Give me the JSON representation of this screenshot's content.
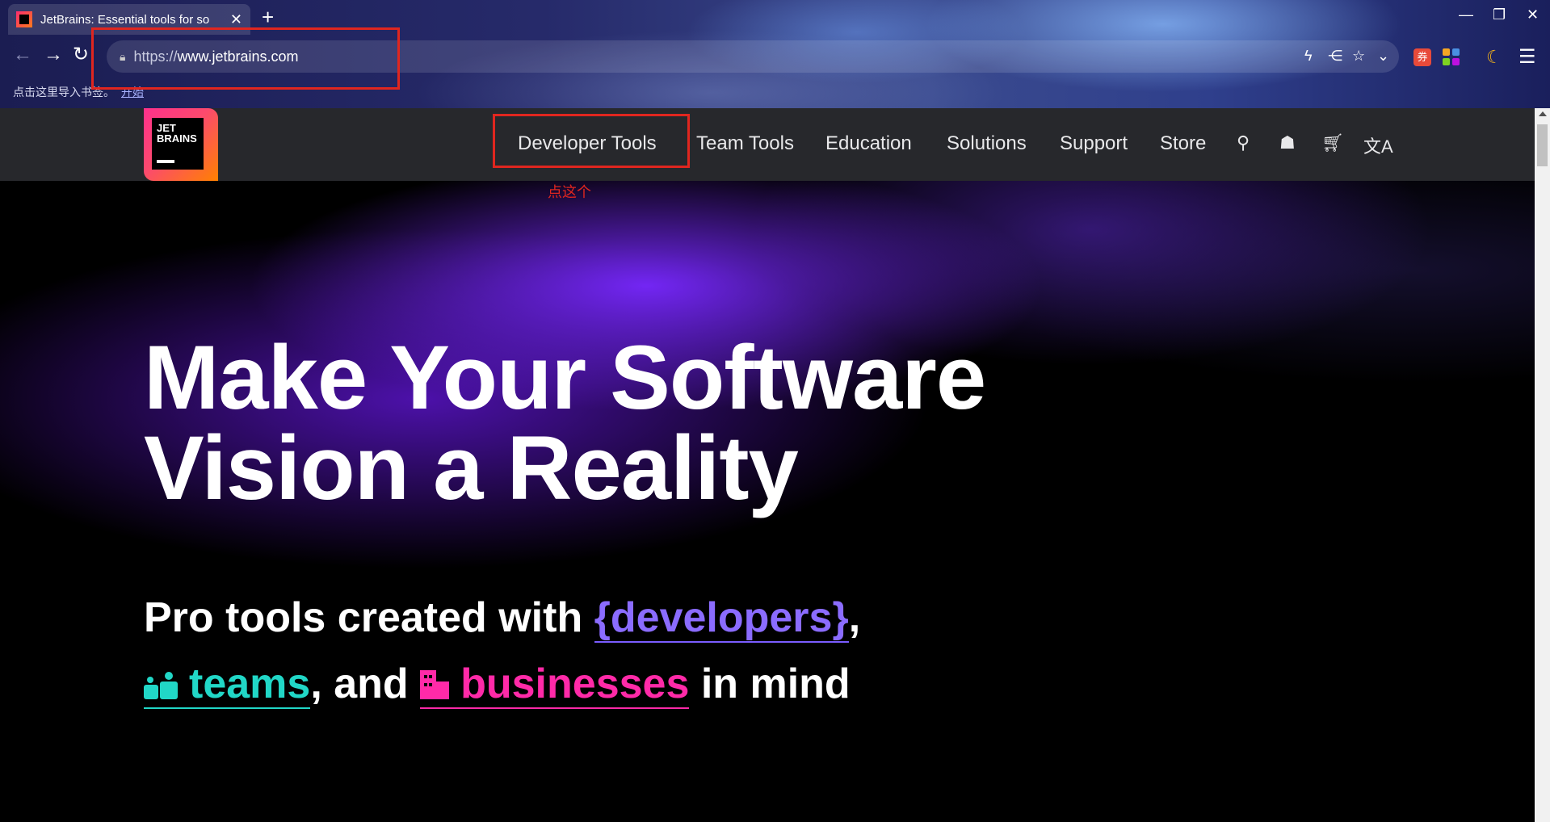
{
  "browser": {
    "tab_title": "JetBrains: Essential tools for so",
    "tab_close": "✕",
    "new_tab": "+",
    "window_min": "—",
    "window_max": "❐",
    "window_close": "✕",
    "back": "←",
    "forward": "→",
    "reload": "↻",
    "url_protocol": "https://",
    "url_host": "www.jetbrains.com",
    "addr_icons": {
      "bolt": "ϟ",
      "share": "⋲",
      "star": "☆",
      "chevron": "⌄"
    },
    "ext_label": "券",
    "menu": "☰",
    "bookmark_prompt": "点击这里导入书签。",
    "bookmark_link": "开始"
  },
  "header": {
    "logo_line1": "JET",
    "logo_line2": "BRAINS",
    "nav": [
      "Developer Tools",
      "Team Tools",
      "Education",
      "Solutions",
      "Support",
      "Store"
    ],
    "icons": {
      "search": "⚲",
      "user": "☗",
      "cart": "🛒︎",
      "language": "文A"
    }
  },
  "annotation": {
    "note": "点这个"
  },
  "hero": {
    "headline_line1": "Make Your Software",
    "headline_line2": "Vision a Reality",
    "sub_prefix": "Pro tools created with ",
    "sub_developers": "{developers}",
    "sub_comma": ",",
    "sub_teams": "teams",
    "sub_and": ", and ",
    "sub_businesses": "businesses",
    "sub_suffix": " in mind"
  },
  "colors": {
    "annotation_red": "#e0261f",
    "developers": "#8b6cff",
    "teams": "#21d7c7",
    "businesses": "#ff2aa8",
    "header_bg": "#27282c"
  }
}
